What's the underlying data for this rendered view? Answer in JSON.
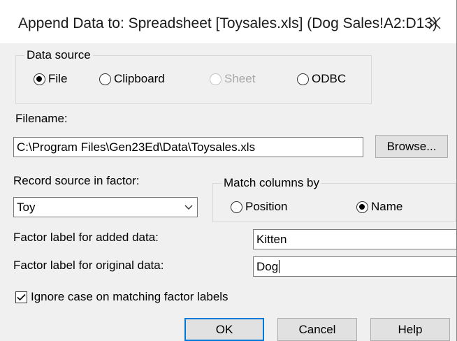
{
  "dialog": {
    "title": "Append Data to: Spreadsheet [Toysales.xls] (Dog Sales!A2:D13)"
  },
  "data_source": {
    "legend": "Data source",
    "options": [
      {
        "label": "File",
        "selected": true,
        "enabled": true
      },
      {
        "label": "Clipboard",
        "selected": false,
        "enabled": true
      },
      {
        "label": "Sheet",
        "selected": false,
        "enabled": false
      },
      {
        "label": "ODBC",
        "selected": false,
        "enabled": true
      }
    ]
  },
  "filename": {
    "label": "Filename:",
    "value": "C:\\Program Files\\Gen23Ed\\Data\\Toysales.xls",
    "browse_label": "Browse..."
  },
  "record_source": {
    "label": "Record source in factor:",
    "value": "Toy"
  },
  "match_columns": {
    "legend": "Match columns by",
    "options": [
      {
        "label": "Position",
        "selected": false
      },
      {
        "label": "Name",
        "selected": true
      }
    ]
  },
  "factor_added": {
    "label": "Factor label for added data:",
    "value": "Kitten"
  },
  "factor_original": {
    "label": "Factor label for original data:",
    "value": "Dog"
  },
  "ignore_case": {
    "label": "Ignore case on matching factor labels",
    "checked": true
  },
  "buttons": {
    "ok": "OK",
    "cancel": "Cancel",
    "help": "Help"
  }
}
